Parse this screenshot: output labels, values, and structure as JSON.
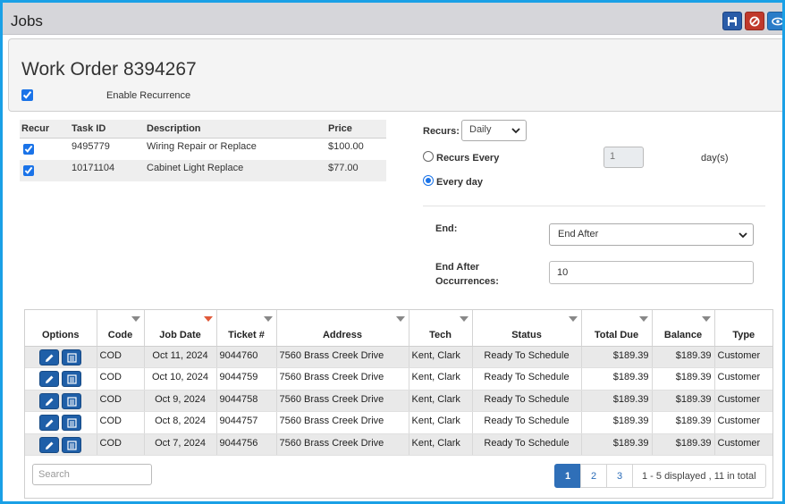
{
  "window": {
    "title": "Jobs"
  },
  "toolbar": {
    "save_icon": "save-icon",
    "cancel_icon": "ban-icon",
    "view_icon": "eye-icon"
  },
  "work_order": {
    "title": "Work Order 8394267",
    "enable_recurrence_label": "Enable Recurrence",
    "enable_recurrence_checked": true
  },
  "tasks": {
    "headers": [
      "Recur",
      "Task ID",
      "Description",
      "Price"
    ],
    "rows": [
      {
        "recur": true,
        "task_id": "9495779",
        "description": "Wiring Repair or Replace",
        "price": "$100.00"
      },
      {
        "recur": true,
        "task_id": "10171104",
        "description": "Cabinet Light Replace",
        "price": "$77.00"
      }
    ]
  },
  "recurrence": {
    "recurs_label": "Recurs:",
    "recurs_value": "Daily",
    "recurs_every_label": "Recurs Every",
    "recurs_every_value": "1",
    "recurs_every_selected": false,
    "days_unit": "day(s)",
    "every_day_label": "Every day",
    "every_day_selected": true,
    "end_label": "End:",
    "end_value": "End After",
    "end_after_label_1": "End After",
    "end_after_label_2": "Occurrences:",
    "end_after_value": "10"
  },
  "jobs": {
    "headers": {
      "options": "Options",
      "code": "Code",
      "job_date": "Job Date",
      "ticket": "Ticket #",
      "address": "Address",
      "tech": "Tech",
      "status": "Status",
      "total_due": "Total Due",
      "balance": "Balance",
      "type": "Type"
    },
    "rows": [
      {
        "code": "COD",
        "job_date": "Oct 11, 2024",
        "ticket": "9044760",
        "address": "7560 Brass Creek Drive",
        "tech": "Kent, Clark",
        "status": "Ready To Schedule",
        "total_due": "$189.39",
        "balance": "$189.39",
        "type": "Customer"
      },
      {
        "code": "COD",
        "job_date": "Oct 10, 2024",
        "ticket": "9044759",
        "address": "7560 Brass Creek Drive",
        "tech": "Kent, Clark",
        "status": "Ready To Schedule",
        "total_due": "$189.39",
        "balance": "$189.39",
        "type": "Customer"
      },
      {
        "code": "COD",
        "job_date": "Oct 9, 2024",
        "ticket": "9044758",
        "address": "7560 Brass Creek Drive",
        "tech": "Kent, Clark",
        "status": "Ready To Schedule",
        "total_due": "$189.39",
        "balance": "$189.39",
        "type": "Customer"
      },
      {
        "code": "COD",
        "job_date": "Oct 8, 2024",
        "ticket": "9044757",
        "address": "7560 Brass Creek Drive",
        "tech": "Kent, Clark",
        "status": "Ready To Schedule",
        "total_due": "$189.39",
        "balance": "$189.39",
        "type": "Customer"
      },
      {
        "code": "COD",
        "job_date": "Oct 7, 2024",
        "ticket": "9044756",
        "address": "7560 Brass Creek Drive",
        "tech": "Kent, Clark",
        "status": "Ready To Schedule",
        "total_due": "$189.39",
        "balance": "$189.39",
        "type": "Customer"
      }
    ],
    "search_placeholder": "Search",
    "pages": [
      "1",
      "2",
      "3"
    ],
    "current_page": "1",
    "pager_info": "1 - 5 displayed , 11 in total"
  },
  "colors": {
    "frame_border": "#1aa0e6",
    "primary": "#2f6fb8",
    "danger": "#c0392b",
    "sorted_arrow": "#e05a3a"
  }
}
